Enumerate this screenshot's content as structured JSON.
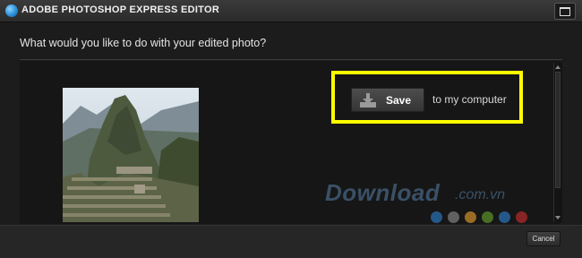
{
  "window": {
    "title": "ADOBE PHOTOSHOP EXPRESS EDITOR",
    "app_icon": "photoshop-express-icon",
    "maximize_icon": "maximize-icon"
  },
  "dialog": {
    "question": "What would you like to do with your edited photo?",
    "save_action": {
      "label": "Save",
      "suffix": "to my computer",
      "icon": "download-icon"
    },
    "highlight_color": "#ffff00",
    "cancel_label": "Cancel"
  },
  "photo": {
    "subject": "mountain-landscape-photo"
  },
  "watermark": {
    "text": "Download",
    "suffix": ".com.vn",
    "dot_colors": [
      "#2a6fb0",
      "#7a7a7a",
      "#c58a2a",
      "#5a8c2a",
      "#2a6fb0",
      "#b02a2a"
    ]
  }
}
